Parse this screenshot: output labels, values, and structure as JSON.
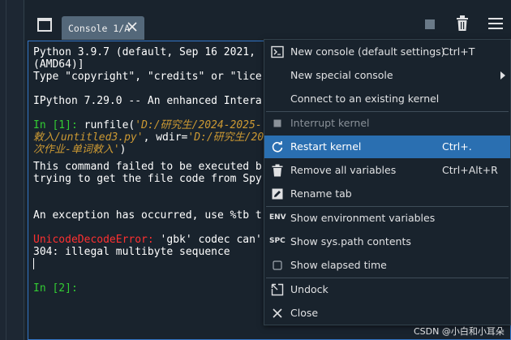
{
  "tab": {
    "label": "Console 1/A"
  },
  "console": {
    "lines": {
      "l1": "Python 3.9.7 (default, Sep 16 2021,",
      "l2": "(AMD64)]",
      "l3": "Type \"copyright\", \"credits\" or \"lice",
      "l4": "IPython 7.29.0 -- An enhanced Intera",
      "in1_prompt": "In [1]:",
      "in1_code": " runfile(",
      "in1_str1": "'D:/研究生/2024-2025-",
      "l6_str": "敕入/untitled3.py'",
      "l6_mid": ", wdir=",
      "l6_str2": "'D:/研究生/20",
      "l7_str": "次作业-单词敕入'",
      "l7_end": ")",
      "l8": "This command failed to be executed b",
      "l9": "trying to get the file code from Spy",
      "l10": "An exception has occurred, use %tb t",
      "err_name": "UnicodeDecodeError:",
      "err_msg": " 'gbk' codec can'",
      "l12": "304: illegal multibyte sequence",
      "in2_prompt": "In [2]:"
    }
  },
  "menu": {
    "items": [
      {
        "label": "New console (default settings)",
        "shortcut": "Ctrl+T",
        "icon": "console-icon"
      },
      {
        "label": "New special console",
        "shortcut": "",
        "icon": ""
      },
      {
        "label": "Connect to an existing kernel",
        "shortcut": "",
        "icon": ""
      },
      {
        "label": "Interrupt kernel",
        "shortcut": "",
        "icon": "stop-icon"
      },
      {
        "label": "Restart kernel",
        "shortcut": "Ctrl+.",
        "icon": "restart-icon"
      },
      {
        "label": "Remove all variables",
        "shortcut": "Ctrl+Alt+R",
        "icon": "trash-icon"
      },
      {
        "label": "Rename tab",
        "shortcut": "",
        "icon": "edit-icon"
      },
      {
        "label": "Show environment variables",
        "shortcut": "",
        "icon": "env-icon",
        "icon_text": "ENV"
      },
      {
        "label": "Show sys.path contents",
        "shortcut": "",
        "icon": "spc-icon",
        "icon_text": "SPC"
      },
      {
        "label": "Show elapsed time",
        "shortcut": "",
        "icon": "checkbox-icon"
      },
      {
        "label": "Undock",
        "shortcut": "",
        "icon": "undock-icon"
      },
      {
        "label": "Close",
        "shortcut": "",
        "icon": "close-icon"
      }
    ]
  },
  "watermark": "CSDN @小白和小耳朵",
  "colors": {
    "background": "#19232d",
    "tab": "#54687a",
    "highlight": "#2a6fb1",
    "prompt": "#33cc33",
    "string": "#cc9933",
    "error": "#ff3030",
    "border_focus": "#3375c6"
  }
}
